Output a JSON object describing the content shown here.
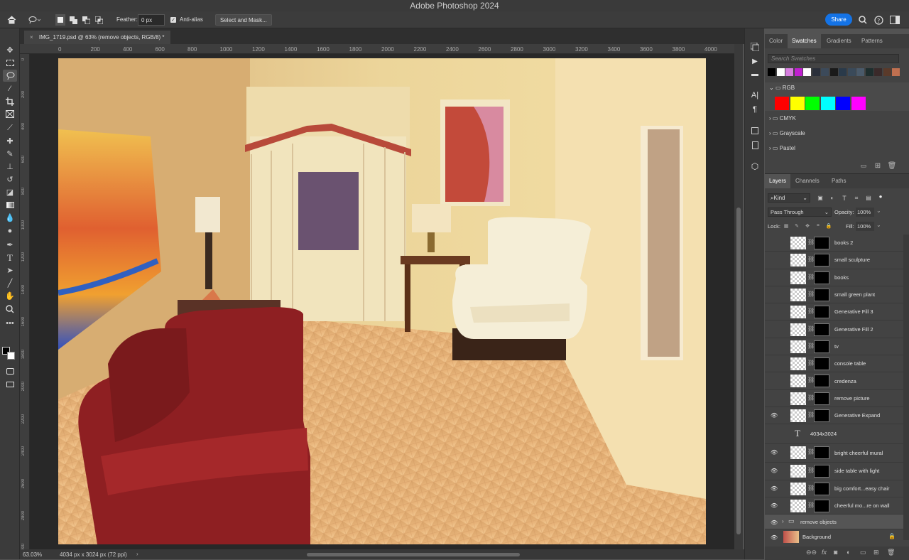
{
  "app": {
    "title": "Adobe Photoshop 2024"
  },
  "options_bar": {
    "feather_label": "Feather:",
    "feather_value": "0 px",
    "antialias_label": "Anti-alias",
    "select_mask_label": "Select and Mask...",
    "share_label": "Share"
  },
  "document": {
    "tab_title": "IMG_1719.psd @ 63% (remove objects, RGB/8) *",
    "ruler_h": [
      "0",
      "200",
      "400",
      "600",
      "800",
      "1000",
      "1200",
      "1400",
      "1600",
      "1800",
      "2000",
      "2200",
      "2400",
      "2600",
      "2800",
      "3000",
      "3200",
      "3400",
      "3600",
      "3800",
      "4000"
    ],
    "ruler_v": [
      "0",
      "200",
      "400",
      "600",
      "800",
      "1000",
      "1200",
      "1400",
      "1600",
      "1800",
      "2000",
      "2200",
      "2400",
      "2600",
      "2800",
      "3000"
    ]
  },
  "status": {
    "zoom": "63.03%",
    "doc_info": "4034 px x 3024 px (72 ppi)"
  },
  "swatches_panel": {
    "tabs": [
      "Color",
      "Swatches",
      "Gradients",
      "Patterns"
    ],
    "active_tab": "Swatches",
    "search_placeholder": "Search Swatches",
    "recent_colors": [
      "#000000",
      "#ffffff",
      "#d77fe0",
      "#c020d0",
      "#ffffff",
      "#2a2f3a",
      "#3c4a5a",
      "#1a1a1a",
      "#2a3a4a",
      "#3a4a5a",
      "#4a5a6a",
      "#1e2e2e",
      "#3a2a2a",
      "#5a3a2a",
      "#c07050"
    ],
    "groups": [
      {
        "name": "RGB",
        "open": true,
        "colors": [
          "#ff0000",
          "#ffff00",
          "#00ff00",
          "#00ffff",
          "#0000ff",
          "#ff00ff"
        ]
      },
      {
        "name": "CMYK",
        "open": false
      },
      {
        "name": "Grayscale",
        "open": false
      },
      {
        "name": "Pastel",
        "open": false
      }
    ]
  },
  "layers_panel": {
    "tabs": [
      "Layers",
      "Channels",
      "Paths"
    ],
    "active_tab": "Layers",
    "filter_kind": "Kind",
    "blend_mode": "Pass Through",
    "opacity_label": "Opacity:",
    "opacity_value": "100%",
    "lock_label": "Lock:",
    "fill_label": "Fill:",
    "fill_value": "100%",
    "layers": [
      {
        "name": "books 2",
        "visible": false,
        "type": "gen"
      },
      {
        "name": "small sculpture",
        "visible": false,
        "type": "gen"
      },
      {
        "name": "books",
        "visible": false,
        "type": "gen"
      },
      {
        "name": "small green plant",
        "visible": false,
        "type": "gen"
      },
      {
        "name": "Generative Fill 3",
        "visible": false,
        "type": "gen"
      },
      {
        "name": "Generative Fill 2",
        "visible": false,
        "type": "gen"
      },
      {
        "name": "tv",
        "visible": false,
        "type": "gen"
      },
      {
        "name": "console table",
        "visible": false,
        "type": "gen"
      },
      {
        "name": "credenza",
        "visible": false,
        "type": "gen"
      },
      {
        "name": "remove picture",
        "visible": false,
        "type": "gen"
      },
      {
        "name": "Generative Expand",
        "visible": true,
        "type": "gen"
      },
      {
        "name": "4034x3024",
        "visible": false,
        "type": "text"
      },
      {
        "name": "bright cheerful mural",
        "visible": true,
        "type": "gen"
      },
      {
        "name": "side table with light",
        "visible": true,
        "type": "gen"
      },
      {
        "name": "big comfort...easy chair",
        "visible": true,
        "type": "gen"
      },
      {
        "name": "cheerful mo...re on wall",
        "visible": true,
        "type": "gen"
      },
      {
        "name": "remove objects",
        "visible": true,
        "type": "group"
      },
      {
        "name": "Background",
        "visible": true,
        "type": "bg"
      }
    ]
  },
  "colors": {
    "ui_dark": "#3b3b3b",
    "accent_share": "#1473e6"
  }
}
